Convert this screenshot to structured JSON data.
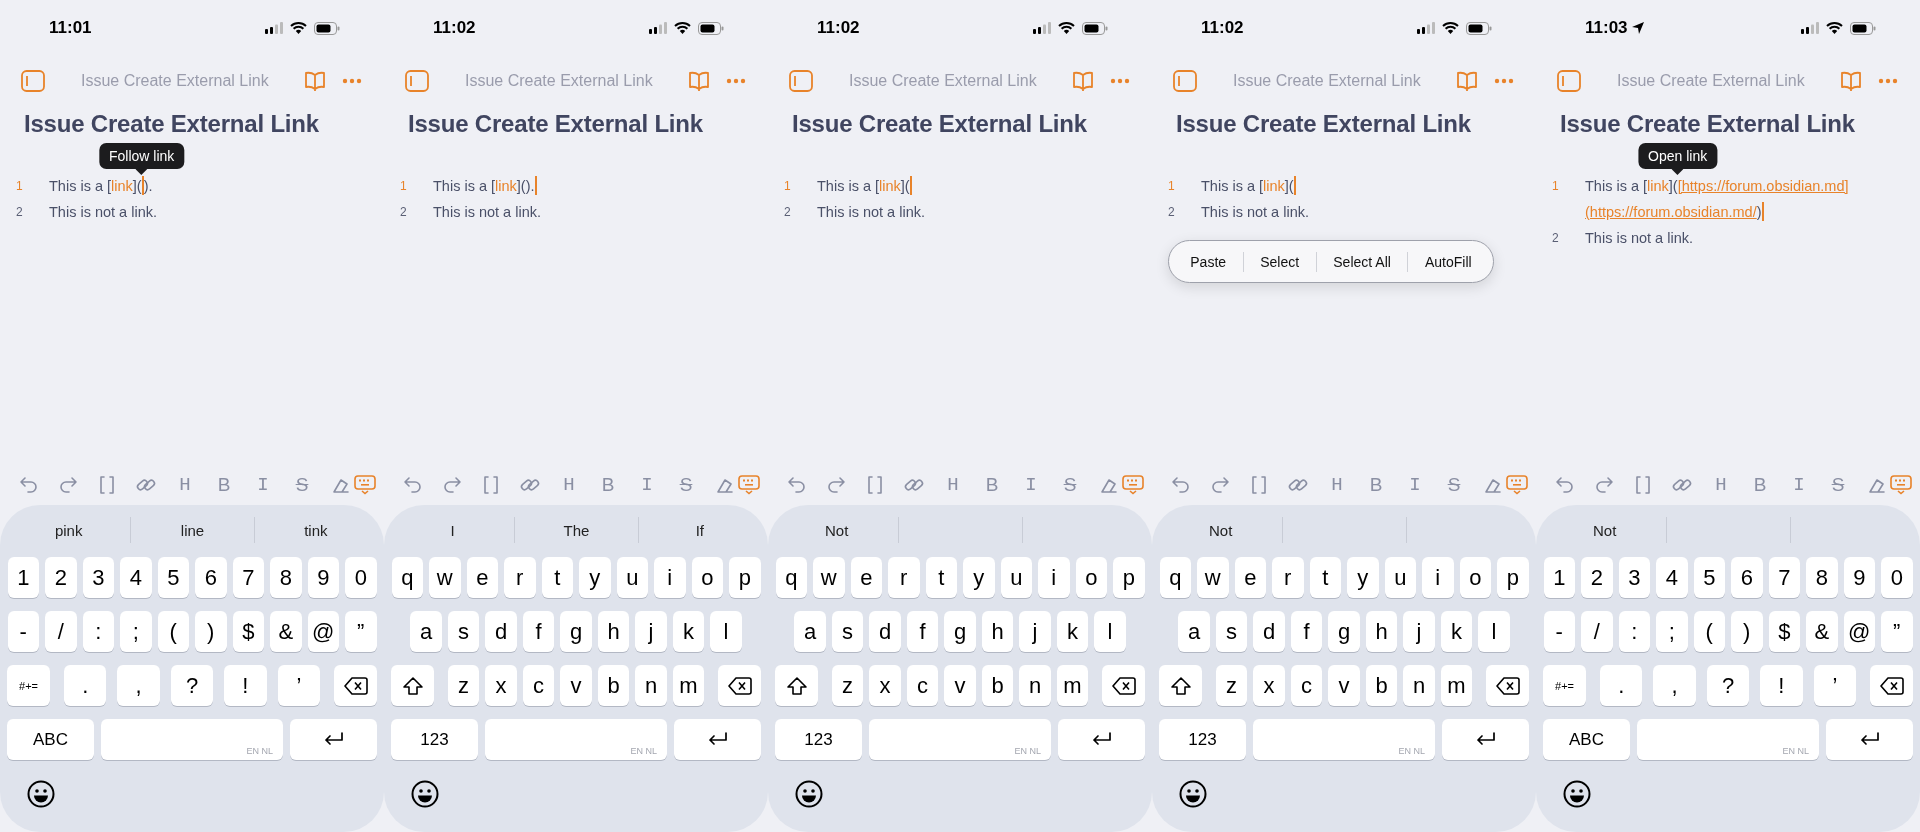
{
  "screens": [
    {
      "time": "11:01",
      "location": false,
      "header_title": "Issue Create External Link",
      "heading": "Issue Create External Link",
      "tooltip": "Follow link",
      "lines": [
        {
          "number": "1",
          "active": true,
          "segments": [
            {
              "kind": "text",
              "text": "This is a ["
            },
            {
              "kind": "link",
              "text": "link"
            },
            {
              "kind": "text",
              "text": "]("
            },
            {
              "kind": "cursor",
              "has_tooltip": true
            },
            {
              "kind": "text",
              "text": ")."
            }
          ]
        },
        {
          "number": "2",
          "active": false,
          "segments": [
            {
              "kind": "text",
              "text": "This is not a link."
            }
          ]
        }
      ],
      "toolbar": {
        "letters": [
          "H",
          "B",
          "I",
          "S"
        ]
      },
      "keyboard": {
        "suggestions": [
          "pink",
          "line",
          "tink"
        ],
        "top_row": [
          "1",
          "2",
          "3",
          "4",
          "5",
          "6",
          "7",
          "8",
          "9",
          "0"
        ],
        "middle_row": [
          "-",
          "/",
          ":",
          ";",
          "(",
          ")",
          "$",
          "&",
          "@",
          "”"
        ],
        "bottom_row": [
          ".",
          ",",
          "?",
          "!",
          "’"
        ],
        "lead": {
          "kind": "label",
          "label": "#+="
        },
        "mode_key": "ABC",
        "space_hint": "EN NL"
      }
    },
    {
      "time": "11:02",
      "location": false,
      "header_title": "Issue Create External Link",
      "heading": "Issue Create External Link",
      "lines": [
        {
          "number": "1",
          "active": true,
          "segments": [
            {
              "kind": "text",
              "text": "This is a ["
            },
            {
              "kind": "link",
              "text": "link"
            },
            {
              "kind": "text",
              "text": "]()."
            },
            {
              "kind": "cursor"
            }
          ]
        },
        {
          "number": "2",
          "active": false,
          "segments": [
            {
              "kind": "text",
              "text": "This is not a link."
            }
          ]
        }
      ],
      "toolbar": {
        "letters": [
          "H",
          "B",
          "I",
          "S"
        ]
      },
      "keyboard": {
        "suggestions": [
          "I",
          "The",
          "If"
        ],
        "top_row": [
          "q",
          "w",
          "e",
          "r",
          "t",
          "y",
          "u",
          "i",
          "o",
          "p"
        ],
        "middle_row": [
          "a",
          "s",
          "d",
          "f",
          "g",
          "h",
          "j",
          "k",
          "l"
        ],
        "bottom_row": [
          "z",
          "x",
          "c",
          "v",
          "b",
          "n",
          "m"
        ],
        "lead": {
          "kind": "shift"
        },
        "mode_key": "123",
        "space_hint": "EN NL"
      }
    },
    {
      "time": "11:02",
      "location": false,
      "header_title": "Issue Create External Link",
      "heading": "Issue Create External Link",
      "lines": [
        {
          "number": "1",
          "active": true,
          "segments": [
            {
              "kind": "text",
              "text": "This is a ["
            },
            {
              "kind": "link",
              "text": "link"
            },
            {
              "kind": "text",
              "text": "]("
            },
            {
              "kind": "cursor"
            }
          ]
        },
        {
          "number": "2",
          "active": false,
          "segments": [
            {
              "kind": "text",
              "text": "This is not a link."
            }
          ]
        }
      ],
      "toolbar": {
        "letters": [
          "H",
          "B",
          "I",
          "S"
        ]
      },
      "keyboard": {
        "suggestions": [
          "Not"
        ],
        "top_row": [
          "q",
          "w",
          "e",
          "r",
          "t",
          "y",
          "u",
          "i",
          "o",
          "p"
        ],
        "middle_row": [
          "a",
          "s",
          "d",
          "f",
          "g",
          "h",
          "j",
          "k",
          "l"
        ],
        "bottom_row": [
          "z",
          "x",
          "c",
          "v",
          "b",
          "n",
          "m"
        ],
        "lead": {
          "kind": "shift"
        },
        "mode_key": "123",
        "space_hint": "EN NL"
      }
    },
    {
      "time": "11:02",
      "location": false,
      "header_title": "Issue Create External Link",
      "heading": "Issue Create External Link",
      "lines": [
        {
          "number": "1",
          "active": true,
          "segments": [
            {
              "kind": "text",
              "text": "This is a ["
            },
            {
              "kind": "link",
              "text": "link"
            },
            {
              "kind": "text",
              "text": "]("
            },
            {
              "kind": "cursor"
            }
          ]
        },
        {
          "number": "2",
          "active": false,
          "segments": [
            {
              "kind": "text",
              "text": "This is not a link."
            }
          ]
        }
      ],
      "context_menu": [
        "Paste",
        "Select",
        "Select All",
        "AutoFill"
      ],
      "toolbar": {
        "letters": [
          "H",
          "B",
          "I",
          "S"
        ]
      },
      "keyboard": {
        "suggestions": [
          "Not"
        ],
        "top_row": [
          "q",
          "w",
          "e",
          "r",
          "t",
          "y",
          "u",
          "i",
          "o",
          "p"
        ],
        "middle_row": [
          "a",
          "s",
          "d",
          "f",
          "g",
          "h",
          "j",
          "k",
          "l"
        ],
        "bottom_row": [
          "z",
          "x",
          "c",
          "v",
          "b",
          "n",
          "m"
        ],
        "lead": {
          "kind": "shift"
        },
        "mode_key": "123",
        "space_hint": "EN NL"
      }
    },
    {
      "time": "11:03",
      "location": true,
      "header_title": "Issue Create External Link",
      "heading": "Issue Create External Link",
      "tooltip": "Open link",
      "lines": [
        {
          "number": "1",
          "active": true,
          "segments": [
            {
              "kind": "text",
              "text": "This is a ["
            },
            {
              "kind": "link",
              "text": "link"
            },
            {
              "kind": "text",
              "text": "]("
            },
            {
              "kind": "url",
              "text": "[https://forum.obsidian.md]",
              "has_tooltip": true
            },
            {
              "kind": "url",
              "text": "(https://forum.obsidian.md/"
            },
            {
              "kind": "text",
              "text": ")"
            },
            {
              "kind": "cursor"
            }
          ]
        },
        {
          "number": "2",
          "active": false,
          "segments": [
            {
              "kind": "text",
              "text": "This is not a link."
            }
          ]
        }
      ],
      "toolbar": {
        "letters": [
          "H",
          "B",
          "I",
          "S"
        ]
      },
      "keyboard": {
        "suggestions": [
          "Not"
        ],
        "top_row": [
          "1",
          "2",
          "3",
          "4",
          "5",
          "6",
          "7",
          "8",
          "9",
          "0"
        ],
        "middle_row": [
          "-",
          "/",
          ":",
          ";",
          "(",
          ")",
          "$",
          "&",
          "@",
          "”"
        ],
        "bottom_row": [
          ".",
          ",",
          "?",
          "!",
          "’"
        ],
        "lead": {
          "kind": "label",
          "label": "#+="
        },
        "mode_key": "ABC",
        "space_hint": "EN NL"
      }
    }
  ]
}
